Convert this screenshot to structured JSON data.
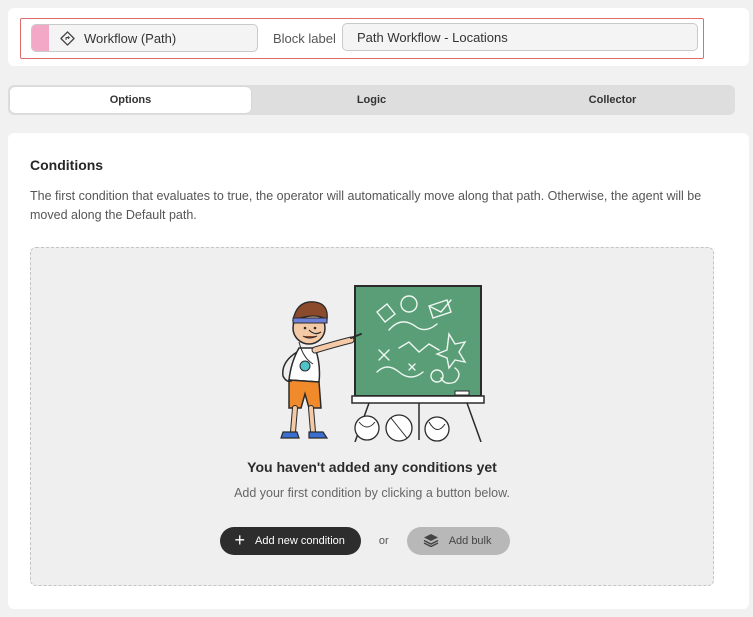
{
  "header": {
    "block_type": "Workflow (Path)",
    "block_type_icon": "path-diamond-icon",
    "block_label_caption": "Block label",
    "block_label_value": "Path Workflow - Locations",
    "accent_color": "#f3a8c7",
    "outline_color": "#e06b6b"
  },
  "tabs": [
    {
      "label": "Options",
      "active": true
    },
    {
      "label": "Logic",
      "active": false
    },
    {
      "label": "Collector",
      "active": false
    }
  ],
  "conditions": {
    "title": "Conditions",
    "description": "The first condition that evaluates to true, the operator will automatically move along that path. Otherwise, the agent will be moved along the Default path.",
    "empty_title": "You haven't added any conditions yet",
    "empty_subtitle": "Add your first condition by clicking a button below.",
    "add_new_label": "Add new condition",
    "or_label": "or",
    "add_bulk_label": "Add bulk",
    "illustration": "coach-chalkboard-illustration"
  }
}
